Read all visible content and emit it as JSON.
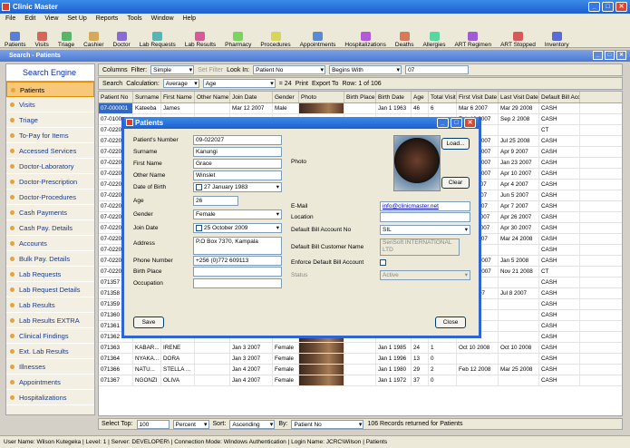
{
  "app": {
    "title": "Clinic Master"
  },
  "menu": [
    "File",
    "Edit",
    "View",
    "Set Up",
    "Reports",
    "Tools",
    "Window",
    "Help"
  ],
  "toolbar": [
    "Patients",
    "Visits",
    "Triage",
    "Cashier",
    "Doctor",
    "Lab Requests",
    "Lab Results",
    "Pharmacy",
    "Procedures",
    "Appointments",
    "Hospitalizations",
    "Deaths",
    "Allergies",
    "ART Regimen",
    "ART Stopped",
    "Inventory"
  ],
  "child_window": {
    "title": "Search - Patients"
  },
  "sidebar": {
    "header": "Search Engine",
    "items": [
      "Patients",
      "Visits",
      "Triage",
      "To-Pay for Items",
      "Accessed Services",
      "Doctor-Laboratory",
      "Doctor-Prescription",
      "Doctor-Procedures",
      "Cash Payments",
      "Cash Pay. Details",
      "Accounts",
      "Bulk Pay. Details",
      "Lab Requests",
      "Lab Request Details",
      "Lab Results",
      "Lab Results EXTRA",
      "Clinical Findings",
      "Ext. Lab Results",
      "Illnesses",
      "Appointments",
      "Hospitalizations"
    ],
    "active": "Patients"
  },
  "filter_bar": {
    "columns_label": "Columns",
    "filter_label": "Filter:",
    "filter_value": "Simple",
    "set_filter": "Set Filter",
    "look_in_label": "Look In:",
    "look_in_value": "Patient No",
    "match_value": "Begins With",
    "search_value": "07"
  },
  "search_bar": {
    "search_label": "Search",
    "calc_label": "Calculation:",
    "calc_value": "Average",
    "field_value": "Age",
    "result": "= 24",
    "print_label": "Print",
    "export_label": "Export To",
    "rows_label": "Row: 1 of 106"
  },
  "grid": {
    "columns": [
      "Patient No",
      "Surname",
      "First Name",
      "Other Name",
      "Join Date",
      "Gender",
      "Photo",
      "Birth Place",
      "Birth Date",
      "Age",
      "Total Visits",
      "First Visit Date",
      "Last Visit Date",
      "Default Bill Account"
    ],
    "rows": [
      [
        "07-000001",
        "Kateeba",
        "James",
        "",
        "Mar 12 2007",
        "Male",
        "",
        "",
        "Jan 1 1963",
        "46",
        "6",
        "Mar 6 2007",
        "Mar 29 2008",
        "CASH"
      ],
      [
        "07-0100",
        "",
        "",
        "",
        "",
        "",
        "",
        "",
        "",
        "",
        "",
        "Feb 12 2007",
        "Sep 2 2008",
        "CASH"
      ],
      [
        "07-0220",
        "",
        "",
        "",
        "",
        "",
        "",
        "",
        "",
        "",
        "",
        "",
        "",
        "CT"
      ],
      [
        "07-0220",
        "",
        "",
        "",
        "",
        "",
        "",
        "",
        "",
        "",
        "",
        "Feb 24 2007",
        "Jul 25 2008",
        "CASH"
      ],
      [
        "07-0220",
        "",
        "",
        "",
        "",
        "",
        "",
        "",
        "",
        "",
        "",
        "Feb 23 2007",
        "Apr 9 2007",
        "CASH"
      ],
      [
        "07-0220",
        "",
        "",
        "",
        "",
        "",
        "",
        "",
        "",
        "",
        "",
        "Feb 23 2007",
        "Jan 23 2007",
        "CASH"
      ],
      [
        "07-0220",
        "",
        "",
        "",
        "",
        "",
        "",
        "",
        "",
        "",
        "",
        "Feb 23 2007",
        "Apr 10 2007",
        "CASH"
      ],
      [
        "07-0220",
        "",
        "",
        "",
        "",
        "",
        "",
        "",
        "",
        "",
        "",
        "Apr 4 2007",
        "Apr 4 2007",
        "CASH"
      ],
      [
        "07-0220",
        "",
        "",
        "",
        "",
        "",
        "",
        "",
        "",
        "",
        "",
        "Jun 2 2007",
        "Jun 5 2007",
        "CASH"
      ],
      [
        "07-0220",
        "",
        "",
        "",
        "",
        "",
        "",
        "",
        "",
        "",
        "",
        "Feb 7 2007",
        "Apr 7 2007",
        "CASH"
      ],
      [
        "07-0220",
        "",
        "",
        "",
        "",
        "",
        "",
        "",
        "",
        "",
        "",
        "Apr 14 2007",
        "Apr 26 2007",
        "CASH"
      ],
      [
        "07-0220",
        "",
        "",
        "",
        "",
        "",
        "",
        "",
        "",
        "",
        "",
        "Apr 30 2007",
        "Apr 30 2007",
        "CASH"
      ],
      [
        "07-0220",
        "",
        "",
        "",
        "",
        "",
        "",
        "",
        "",
        "",
        "",
        "Mar 3 2007",
        "Mar 24 2008",
        "CASH"
      ],
      [
        "07-0220",
        "",
        "",
        "",
        "",
        "",
        "",
        "",
        "",
        "",
        "",
        "",
        "",
        "CASH"
      ],
      [
        "07-0220",
        "",
        "",
        "",
        "",
        "",
        "",
        "",
        "",
        "",
        "",
        "Dec 28 2007",
        "Jan 5 2008",
        "CASH"
      ],
      [
        "07-0220",
        "",
        "",
        "",
        "",
        "",
        "",
        "",
        "",
        "",
        "",
        "Nov 21 2007",
        "Nov 21 2008",
        "CT"
      ],
      [
        "071357",
        "",
        "",
        "",
        "",
        "",
        "",
        "",
        "",
        "",
        "",
        "",
        "",
        "CASH"
      ],
      [
        "071358",
        "",
        "",
        "",
        "",
        "",
        "",
        "",
        "",
        "",
        "",
        "Jul 4 2007",
        "Jul 8 2007",
        "CASH"
      ],
      [
        "071359",
        "",
        "",
        "",
        "",
        "",
        "",
        "",
        "",
        "",
        "",
        "",
        "",
        "CASH"
      ],
      [
        "071360",
        "",
        "",
        "",
        "",
        "",
        "",
        "",
        "",
        "",
        "",
        "",
        "",
        "CASH"
      ],
      [
        "071361",
        "BANURA",
        "GLADESI",
        "",
        "Jan 3 2007",
        "Female",
        "",
        "",
        "Jan 1 1975",
        "34",
        "0",
        "",
        "",
        "CASH"
      ],
      [
        "071362",
        "NAMA...",
        "JOSEPHI...",
        "",
        "Jan 3 2007",
        "Female",
        "",
        "",
        "Jan 1 1957",
        "52",
        "0",
        "",
        "",
        "CASH"
      ],
      [
        "071363",
        "KABAR...",
        "IRENE",
        "",
        "Jan 3 2007",
        "Female",
        "",
        "",
        "Jan 1 1985",
        "24",
        "1",
        "Oct 10 2008",
        "Oct 10 2008",
        "CASH"
      ],
      [
        "071364",
        "NYAKA...",
        "DORA",
        "",
        "Jan 3 2007",
        "Female",
        "",
        "",
        "Jan 1 1996",
        "13",
        "0",
        "",
        "",
        "CASH"
      ],
      [
        "071366",
        "NATU...",
        "STELLA ...",
        "",
        "Jan 4 2007",
        "Female",
        "",
        "",
        "Jan 1 1980",
        "29",
        "2",
        "Feb 12 2008",
        "Mar 25 2008",
        "CASH"
      ],
      [
        "071367",
        "NGONZI",
        "OLIVA",
        "",
        "Jan 4 2007",
        "Female",
        "",
        "",
        "Jan 1 1972",
        "37",
        "0",
        "",
        "",
        "CASH"
      ]
    ]
  },
  "bottom_bar": {
    "select_top_label": "Select Top:",
    "select_top_value": "100",
    "percent_value": "Percent",
    "sort_label": "Sort:",
    "sort_value": "Ascending",
    "by_label": "By:",
    "by_value": "Patient No",
    "result": "106 Records returned for Patients"
  },
  "status_bar": "User Name: Wilson Kutegeka | Level: 1 | Server: DEVELOPER\\ | Connection Mode: Windows Authentication | Login Name: JCRC\\Wilson | Patients",
  "dialog": {
    "title": "Patients",
    "patients_number_label": "Patient's Number",
    "patients_number": "09-022027",
    "surname_label": "Surname",
    "surname": "Kanungi",
    "first_name_label": "First Name",
    "first_name": "Grace",
    "other_name_label": "Other Name",
    "other_name": "Winslet",
    "dob_label": "Date of Birth",
    "dob": "27   January   1983",
    "age_label": "Age",
    "age": "26",
    "gender_label": "Gender",
    "gender": "Female",
    "join_date_label": "Join Date",
    "join_date": "25   October   2009",
    "address_label": "Address",
    "address": "P.O Box 7370, Kampala",
    "phone_label": "Phone Number",
    "phone": "+256 (0)772 609113",
    "birth_place_label": "Birth Place",
    "birth_place": "",
    "occupation_label": "Occupation",
    "occupation": "",
    "photo_label": "Photo",
    "email_label": "E-Mail",
    "email": "info@clinicmaster.net",
    "location_label": "Location",
    "location": "",
    "bill_acc_label": "Default Bill Account No",
    "bill_acc": "SIL",
    "bill_cust_label": "Default Bill Customer Name",
    "bill_cust": "SeriSoft INTERNATIONAL LTD",
    "enforce_label": "Enforce Default Bill Account",
    "status_label": "Status",
    "status": "Active",
    "load_btn": "Load...",
    "clear_btn": "Clear",
    "save_btn": "Save",
    "close_btn": "Close"
  }
}
